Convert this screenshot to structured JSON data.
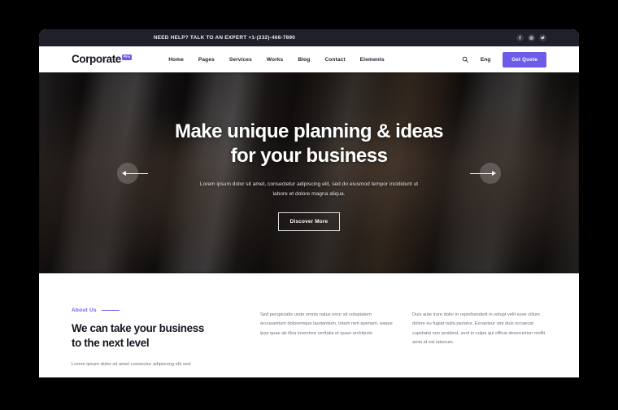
{
  "topbar": {
    "message": "NEED HELP? TALK TO AN EXPERT +1-(232)-466-7890",
    "social": [
      {
        "name": "facebook-icon",
        "label": "Facebook"
      },
      {
        "name": "instagram-icon",
        "label": "Instagram"
      },
      {
        "name": "twitter-icon",
        "label": "Twitter"
      }
    ]
  },
  "nav": {
    "brand": "Corporate",
    "brand_badge": "Pro",
    "links": [
      {
        "label": "Home"
      },
      {
        "label": "Pages"
      },
      {
        "label": "Services"
      },
      {
        "label": "Works"
      },
      {
        "label": "Blog"
      },
      {
        "label": "Contact"
      },
      {
        "label": "Elements"
      }
    ],
    "search_icon": "search-icon",
    "language": "Eng",
    "cta": "Get Quote"
  },
  "hero": {
    "title_line1": "Make unique planning & ideas",
    "title_line2": "for your business",
    "subtitle": "Lorem ipsum dolor sit amet, consectetur adipiscing elit, sed do eiusmod tempor incididunt ut labore et dolore magna aliqua.",
    "button": "Discover More",
    "prev_label": "Previous slide",
    "next_label": "Next slide"
  },
  "about": {
    "eyebrow": "About Us",
    "title_line1": "We can take your business",
    "title_line2": "to the next level",
    "left_text": "Lorem ipsum dolor sit amet consectur adipiscing elit sed",
    "column_middle": "Sed perspiciatis unde omnis natus error sit voluptatem accusantium doloremque laudantium, totam rem aperiam. eaque ipsa quae ab illoa inventore veritatis et quasi architecto",
    "column_right": "Duis aute irure dolor in reprehenderit in volupt velit esse cillum dolore eu fugiat nulla pariatur. Excepteur sint duis occaecat cupidatat non proident, sunt in culpa qui officia deseruntion mollit anim id est laborum."
  },
  "colors": {
    "accent": "#6c5ce7",
    "topbar_bg": "#20202a",
    "heading": "#15151f",
    "body_text": "#70707e",
    "page_bg": "#ffffff",
    "canvas_bg": "#000000"
  }
}
